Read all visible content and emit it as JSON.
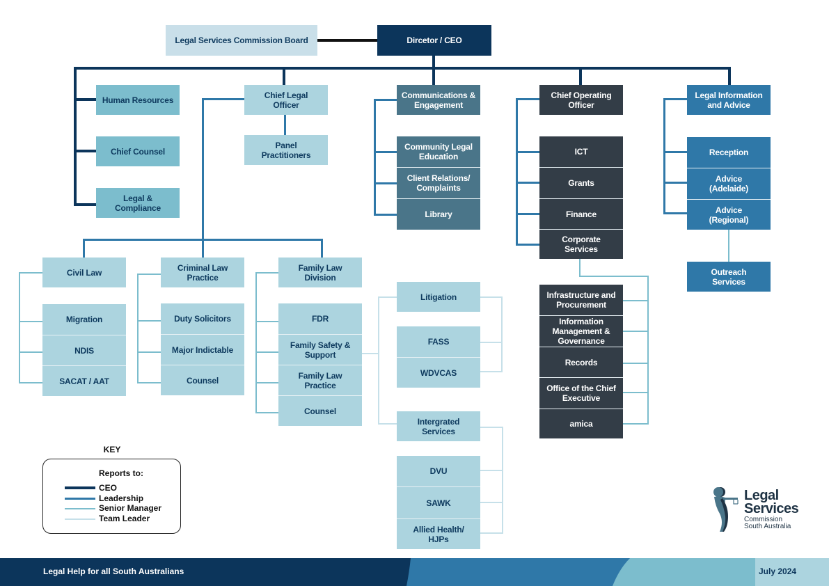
{
  "board": "Legal Services Commission Board",
  "ceo": "Dircetor / CEO",
  "ceo_direct": {
    "human_resources": "Human Resources",
    "chief_counsel": "Chief Counsel",
    "legal_compliance": "Legal & Compliance"
  },
  "chief_legal_officer": {
    "title": "Chief Legal Officer",
    "panel": "Panel Practitioners",
    "civil_law": {
      "title": "Civil Law",
      "teams": [
        "Migration",
        "NDIS",
        "SACAT / AAT"
      ]
    },
    "criminal_law": {
      "title": "Criminal Law Practice",
      "teams": [
        "Duty Solicitors",
        "Major Indictable",
        "Counsel"
      ]
    },
    "family_law": {
      "title": "Family Law Division",
      "teams": [
        "FDR",
        "Family Safety & Support",
        "Family Law Practice",
        "Counsel"
      ]
    },
    "family_safety_units": {
      "litigation": {
        "title": "Litigation",
        "teams": [
          "FASS",
          "WDVCAS"
        ]
      },
      "integrated": {
        "title": "Intergrated Services",
        "teams": [
          "DVU",
          "SAWK",
          "Allied Health/ HJPs"
        ]
      }
    }
  },
  "communications": {
    "title": "Communications & Engagement",
    "teams": [
      "Community Legal Education",
      "Client Relations/ Complaints",
      "Library"
    ]
  },
  "coo": {
    "title": "Chief Operating Officer",
    "teams": [
      "ICT",
      "Grants",
      "Finance",
      "Corporate Services"
    ],
    "corporate_services_teams": [
      "Infrastructure and Procurement",
      "Information Management & Governance",
      "Records",
      "Office of the Chief Executive",
      "amica"
    ]
  },
  "legal_info": {
    "title": "Legal Information and Advice",
    "teams": [
      "Reception",
      "Advice (Adelaide)",
      "Advice (Regional)"
    ],
    "outreach": "Outreach Services"
  },
  "key": {
    "title": "KEY",
    "heading": "Reports to:",
    "items": [
      {
        "label": "CEO",
        "color": "#0c355b"
      },
      {
        "label": "Leadership",
        "color": "#2f78a8"
      },
      {
        "label": "Senior Manager",
        "color": "#7cbdcd"
      },
      {
        "label": "Team Leader",
        "color": "#c6e0e9"
      }
    ]
  },
  "logo": {
    "line1": "Legal",
    "line2": "Services",
    "line3": "Commission",
    "line4": "South Australia"
  },
  "footer": {
    "tagline": "Legal Help for all South Australians",
    "date": "July 2024"
  },
  "colors": {
    "ceo_navy": "#0c355b",
    "leadership_blue": "#2f78a8",
    "senior_teal": "#7cbdcd",
    "team_light": "#acd4df",
    "comm_slate": "#4a7589",
    "coo_charcoal": "#333d47"
  }
}
